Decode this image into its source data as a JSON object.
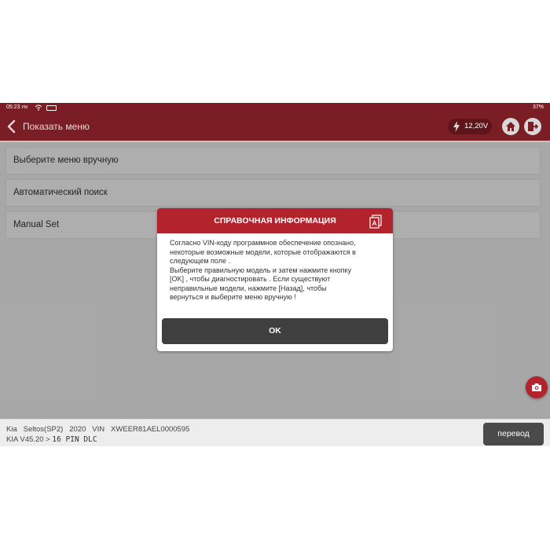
{
  "status_bar": {
    "time": "05:23",
    "time_suffix": "PM",
    "battery": "37%",
    "icons": [
      "wifi-icon",
      "keyboard-icon"
    ]
  },
  "app_bar": {
    "title": "Показать меню",
    "voltage": "12,20V",
    "icons": [
      "back-arrow-icon",
      "lightning-icon",
      "home-icon",
      "exit-icon"
    ]
  },
  "menu": {
    "items": [
      {
        "label": "Выберите меню вручную"
      },
      {
        "label": "Автоматический поиск"
      },
      {
        "label": "Manual Set"
      }
    ]
  },
  "dialog": {
    "title": "СПРАВОЧНАЯ ИНФОРМАЦИЯ",
    "message_lines": [
      "Согласно VIN-коду программное обеспечение опознано,",
      "некоторые возможные модели, которые отображаются в",
      "следующем поле .",
      "Выберите правильную модель и затем нажмите кнопку",
      "[OK] , чтобы диагностировать . Если существуют",
      "неправильные модели, нажмите [Назад], чтобы",
      "вернуться и выберите меню вручную !"
    ],
    "ok_label": "OK",
    "header_icon": "document-icon"
  },
  "bottom_bar": {
    "vehicle_info": "Kia   Seltos(SP2)   2020   VIN   XWEER81AEL0000595",
    "version": "KIA V45.20 >",
    "connector": "16 PIN DLC",
    "translate_label": "перевод"
  },
  "camera_icon": "camera-icon",
  "colors": {
    "app_bar": "#7a1d24",
    "dialog_header": "#b3232c",
    "ok_button": "#3f3f3f",
    "accent_red": "#b3232c"
  }
}
